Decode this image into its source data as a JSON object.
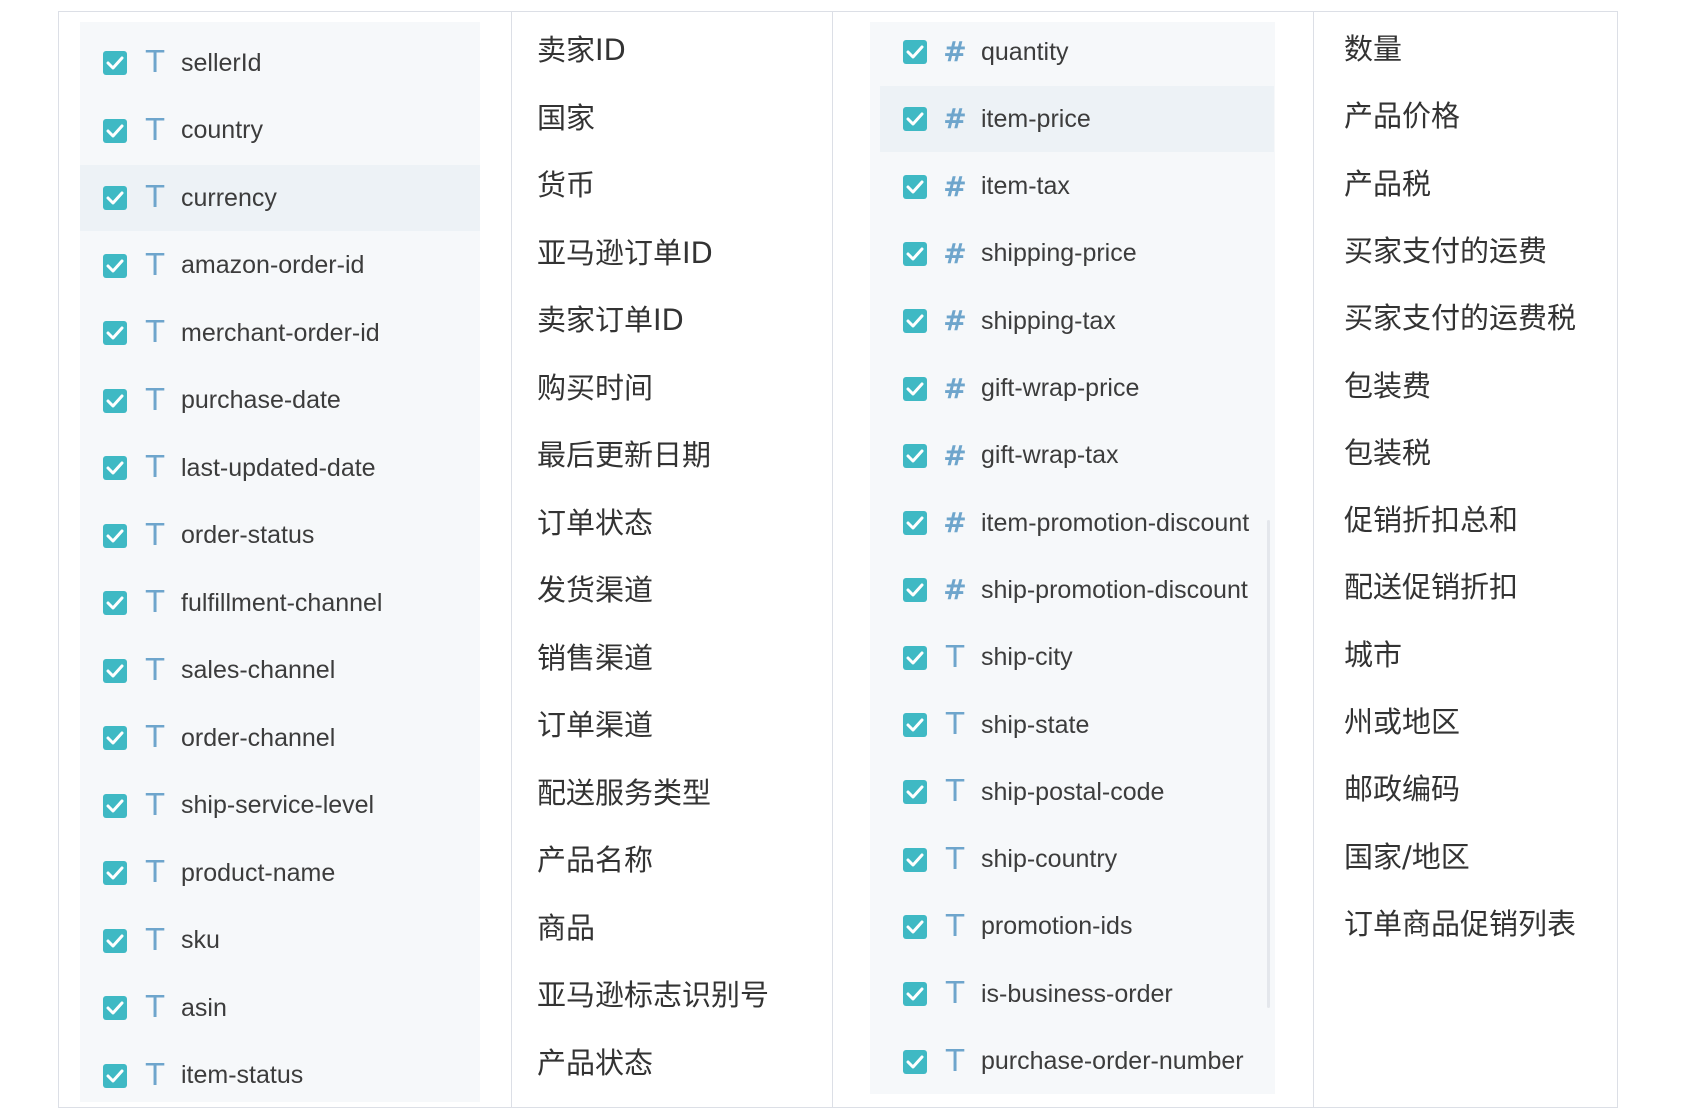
{
  "left_fields": [
    {
      "name": "sellerId",
      "type": "text",
      "label": "卖家ID",
      "checked": true
    },
    {
      "name": "country",
      "type": "text",
      "label": "国家",
      "checked": true
    },
    {
      "name": "currency",
      "type": "text",
      "label": "货币",
      "checked": true,
      "highlighted": true
    },
    {
      "name": "amazon-order-id",
      "type": "text",
      "label": "亚马逊订单ID",
      "checked": true
    },
    {
      "name": "merchant-order-id",
      "type": "text",
      "label": "卖家订单ID",
      "checked": true
    },
    {
      "name": "purchase-date",
      "type": "text",
      "label": "购买时间",
      "checked": true
    },
    {
      "name": "last-updated-date",
      "type": "text",
      "label": "最后更新日期",
      "checked": true
    },
    {
      "name": "order-status",
      "type": "text",
      "label": "订单状态",
      "checked": true
    },
    {
      "name": "fulfillment-channel",
      "type": "text",
      "label": "发货渠道",
      "checked": true
    },
    {
      "name": "sales-channel",
      "type": "text",
      "label": "销售渠道",
      "checked": true
    },
    {
      "name": "order-channel",
      "type": "text",
      "label": "订单渠道",
      "checked": true
    },
    {
      "name": "ship-service-level",
      "type": "text",
      "label": "配送服务类型",
      "checked": true
    },
    {
      "name": "product-name",
      "type": "text",
      "label": "产品名称",
      "checked": true
    },
    {
      "name": "sku",
      "type": "text",
      "label": "商品",
      "checked": true
    },
    {
      "name": "asin",
      "type": "text",
      "label": "亚马逊标志识别号",
      "checked": true
    },
    {
      "name": "item-status",
      "type": "text",
      "label": "产品状态",
      "checked": true
    }
  ],
  "right_fields": [
    {
      "name": "quantity",
      "type": "number",
      "label": "数量",
      "checked": true
    },
    {
      "name": "item-price",
      "type": "number",
      "label": "产品价格",
      "checked": true,
      "highlighted": true
    },
    {
      "name": "item-tax",
      "type": "number",
      "label": "产品税",
      "checked": true
    },
    {
      "name": "shipping-price",
      "type": "number",
      "label": "买家支付的运费",
      "checked": true
    },
    {
      "name": "shipping-tax",
      "type": "number",
      "label": "买家支付的运费税",
      "checked": true
    },
    {
      "name": "gift-wrap-price",
      "type": "number",
      "label": "包装费",
      "checked": true
    },
    {
      "name": "gift-wrap-tax",
      "type": "number",
      "label": "包装税",
      "checked": true
    },
    {
      "name": "item-promotion-discount",
      "type": "number",
      "label": "促销折扣总和",
      "checked": true
    },
    {
      "name": "ship-promotion-discount",
      "type": "number",
      "label": "配送促销折扣",
      "checked": true
    },
    {
      "name": "ship-city",
      "type": "text",
      "label": "城市",
      "checked": true
    },
    {
      "name": "ship-state",
      "type": "text",
      "label": "州或地区",
      "checked": true
    },
    {
      "name": "ship-postal-code",
      "type": "text",
      "label": "邮政编码",
      "checked": true
    },
    {
      "name": "ship-country",
      "type": "text",
      "label": "国家/地区",
      "checked": true
    },
    {
      "name": "promotion-ids",
      "type": "text",
      "label": "订单商品促销列表",
      "checked": true
    },
    {
      "name": "is-business-order",
      "type": "text",
      "label": "",
      "checked": true
    },
    {
      "name": "purchase-order-number",
      "type": "text",
      "label": "",
      "checked": true
    }
  ],
  "type_icons": {
    "text": "T",
    "number": "#"
  },
  "colors": {
    "checkbox": "#3fb9c4",
    "type_icon": "#6ea5cc",
    "panel": "#f6f8fa",
    "highlight": "#edf2f6"
  }
}
